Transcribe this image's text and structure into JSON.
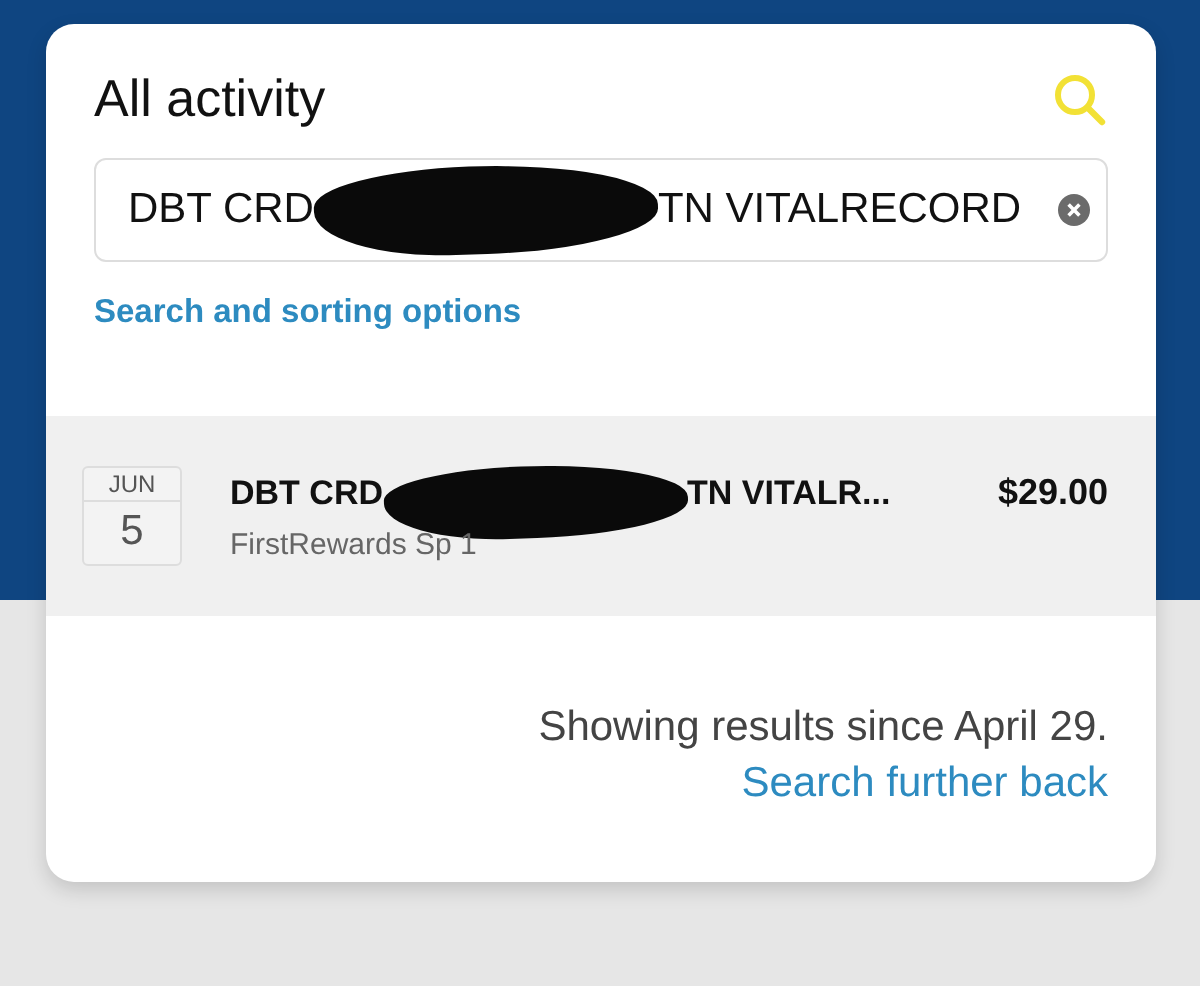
{
  "header": {
    "title": "All activity"
  },
  "search_field": {
    "value_start": "DBT CRD",
    "value_end": "TN VITALRECORD"
  },
  "options_link": "Search and sorting options",
  "transactions": [
    {
      "month": "JUN",
      "day": "5",
      "title_start": "DBT CRD",
      "title_end": "TN VITALR...",
      "subtitle": "FirstRewards Sp 1",
      "amount": "$29.00"
    }
  ],
  "footer": {
    "note": "Showing results since April 29.",
    "link": "Search further back"
  }
}
